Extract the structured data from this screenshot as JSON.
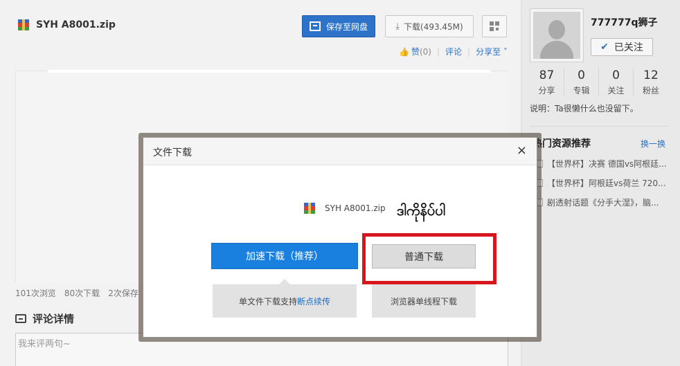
{
  "file": {
    "name": "SYH A8001.zip"
  },
  "toolbar": {
    "save_label": "保存至网盘",
    "download_label": "下载(493.45M)"
  },
  "social": {
    "like_label": "赞",
    "like_count": "(0)",
    "comment_label": "评论",
    "share_label": "分享至"
  },
  "stats": {
    "views": "101次浏览",
    "downloads": "80次下载",
    "saves": "2次保存"
  },
  "comments": {
    "title": "评论详情",
    "placeholder": "我来评两句~"
  },
  "user": {
    "name": "777777q狮子",
    "follow_label": "已关注",
    "stats": [
      {
        "num": "87",
        "label": "分享"
      },
      {
        "num": "0",
        "label": "专辑"
      },
      {
        "num": "0",
        "label": "关注"
      },
      {
        "num": "12",
        "label": "粉丝"
      }
    ],
    "description": "说明：Ta很懒什么也没留下。"
  },
  "hot": {
    "title": "热门资源推荐",
    "refresh": "换一换",
    "items": [
      "【世界杯】决赛 德国vs阿根廷...",
      "【世界杯】阿根廷vs荷兰 720...",
      "剧透射话题《分手大湿》，脑..."
    ]
  },
  "modal": {
    "title": "文件下载",
    "close": "×",
    "file_name": "SYH A8001.zip",
    "annotation": "ဒါကိုနိပ်ပါ",
    "fast_label": "加速下载（推荐）",
    "normal_label": "普通下载",
    "fast_tip_prefix": "单文件下载支持",
    "fast_tip_link": "断点续传",
    "normal_tip": "浏览器单线程下载"
  },
  "colors": {
    "primary": "#2c73c9",
    "fast_button": "#1a80e0",
    "highlight_box": "#d8161d"
  }
}
